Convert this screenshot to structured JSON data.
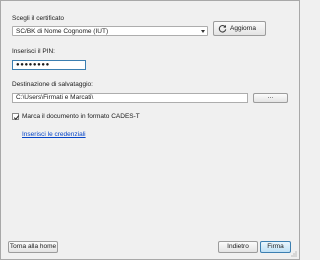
{
  "certificate": {
    "label": "Scegli il certificato",
    "selected": "SC/BK di Nome Cognome (IUT)",
    "refresh_label": "Aggiorna"
  },
  "pin": {
    "label": "Inserisci il PIN:",
    "value": "●●●●●●●●"
  },
  "destination": {
    "label": "Destinazione di salvataggio:",
    "value": "C:\\Users\\Firmati e Marcati\\",
    "browse_label": "..."
  },
  "timestamp": {
    "label": "Marca il documento in formato CADES-T",
    "checked": true
  },
  "credentials_link": "Inserisci le credenziali",
  "footer": {
    "home_label": "Torna alla home",
    "back_label": "Indietro",
    "sign_label": "Firma"
  },
  "colors": {
    "link": "#0645c8",
    "primary_border": "#3c7fb1",
    "window_bg": "#f0f0f0"
  },
  "icons": {
    "refresh": "refresh-icon",
    "combo_arrow": "chevron-down-icon",
    "checkbox": "check-icon"
  }
}
